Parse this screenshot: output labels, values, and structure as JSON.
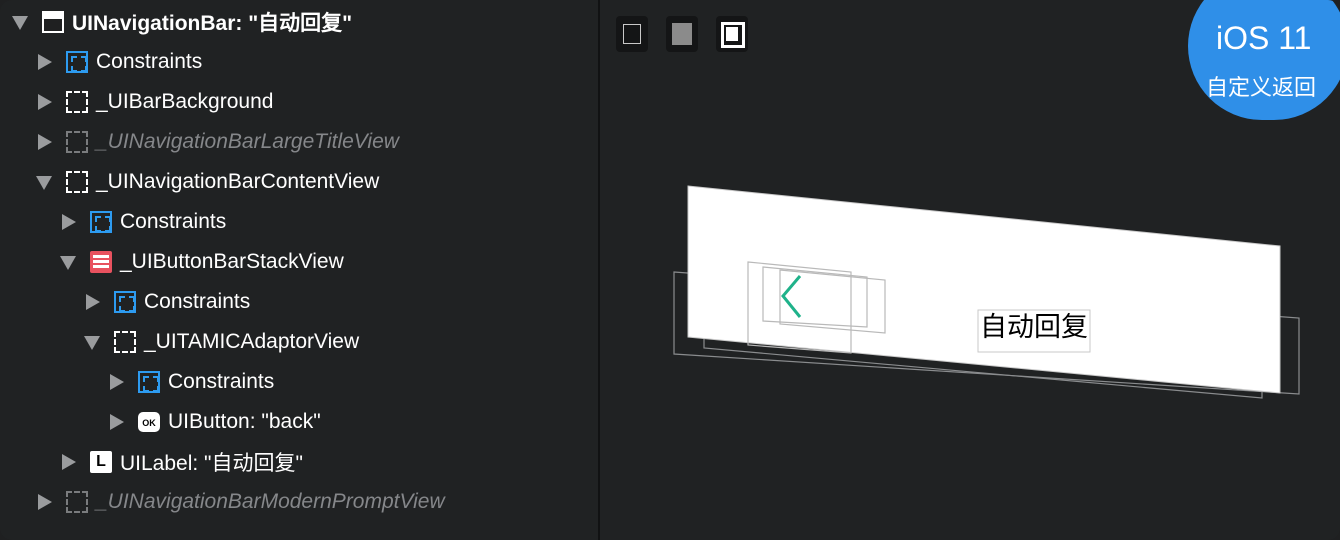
{
  "tree": [
    {
      "label": "UINavigationBar: \"自动回复\"",
      "icon": "navbar-icon",
      "expanded": true,
      "style": "bold"
    },
    {
      "label": "Constraints",
      "icon": "constraints-icon",
      "expanded": false,
      "style": "normal"
    },
    {
      "label": "_UIBarBackground",
      "icon": "view-icon",
      "expanded": false,
      "style": "normal"
    },
    {
      "label": "_UINavigationBarLargeTitleView",
      "icon": "hidden-view-icon",
      "expanded": false,
      "style": "dim"
    },
    {
      "label": "_UINavigationBarContentView",
      "icon": "view-icon",
      "expanded": true,
      "style": "normal"
    },
    {
      "label": "Constraints",
      "icon": "constraints-icon",
      "expanded": false,
      "style": "normal"
    },
    {
      "label": "_UIButtonBarStackView",
      "icon": "stack-view-icon",
      "expanded": true,
      "style": "normal"
    },
    {
      "label": "Constraints",
      "icon": "constraints-icon",
      "expanded": false,
      "style": "normal"
    },
    {
      "label": "_UITAMICAdaptorView",
      "icon": "view-icon",
      "expanded": true,
      "style": "normal"
    },
    {
      "label": "Constraints",
      "icon": "constraints-icon",
      "expanded": false,
      "style": "normal"
    },
    {
      "label": "UIButton: \"back\"",
      "icon": "button-icon",
      "icon_text": "OK",
      "expanded": false,
      "style": "normal"
    },
    {
      "label": "UILabel: \"自动回复\"",
      "icon": "label-icon",
      "icon_text": "L",
      "expanded": false,
      "style": "normal"
    },
    {
      "label": "_UINavigationBarModernPromptView",
      "icon": "hidden-view-icon",
      "expanded": false,
      "style": "dim"
    }
  ],
  "badge": {
    "line1": "iOS 11",
    "line2": "自定义返回"
  },
  "canvas": {
    "title_label": "自动回复",
    "back_glyph": "<"
  },
  "colors": {
    "accent": "#2f8fe8",
    "back_tint": "#1fb28a",
    "constraint": "#2d9bf0",
    "stack": "#e8525f"
  }
}
